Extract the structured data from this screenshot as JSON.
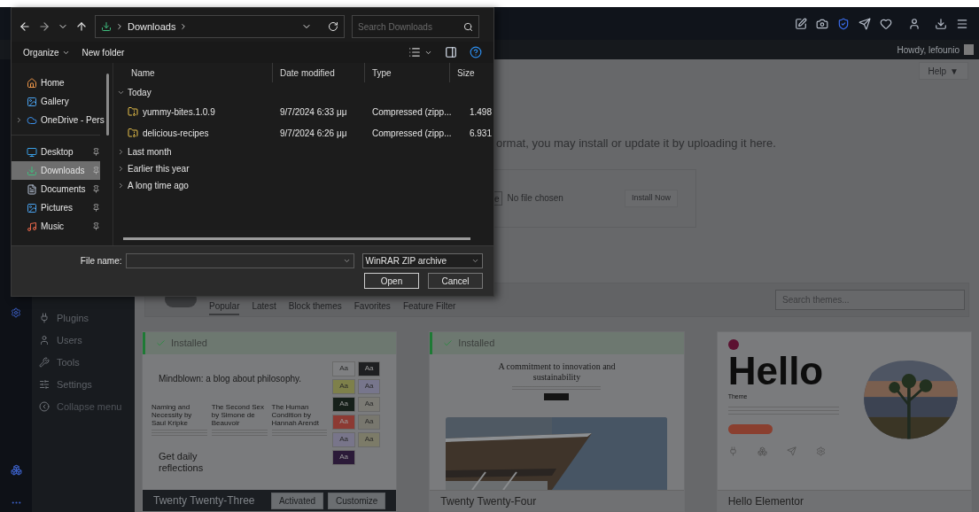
{
  "admin_bar": {
    "greeting": "Howdy, lefounio"
  },
  "help": {
    "label": "Help",
    "caret": "▼"
  },
  "upload": {
    "intro": "ormat, you may install or update it by uploading it here.",
    "choose_button": "e",
    "file_status": "No file chosen",
    "install_button": "Install Now"
  },
  "admin_menu": [
    {
      "label": "Plugins",
      "kind": "plugins"
    },
    {
      "label": "Users",
      "kind": "users"
    },
    {
      "label": "Tools",
      "kind": "tools"
    },
    {
      "label": "Settings",
      "kind": "settings"
    },
    {
      "label": "Collapse menu",
      "kind": "collapse"
    }
  ],
  "theme_filters": {
    "tabs": [
      {
        "label": "Popular",
        "selected": true
      },
      {
        "label": "Latest",
        "selected": false
      },
      {
        "label": "Block themes",
        "selected": false
      },
      {
        "label": "Favorites",
        "selected": false
      },
      {
        "label": "Feature Filter",
        "selected": false
      }
    ],
    "search_placeholder": "Search themes..."
  },
  "themes": [
    {
      "kind": "twentythree",
      "name": "Twenty Twenty-Three",
      "installed": true,
      "status": "Installed",
      "active": true,
      "actions": [
        "Activated",
        "Customize"
      ],
      "preview": {
        "headline": "Mindblown: a blog about philosophy.",
        "posts": [
          "Naming and Necessity by Saul Kripke",
          "The Second Sex by Simone de Beauvoir",
          "The Human Condition by Hannah Arendt"
        ],
        "footer_heading": "Get daily reflections",
        "swatches": [
          {
            "label": "Aa",
            "color": "#7f8082"
          },
          {
            "label": "Aa",
            "color": "#1e1f21"
          },
          {
            "label": "Aa",
            "color": "#7e804a"
          },
          {
            "label": "Aa",
            "color": "#77768c"
          },
          {
            "label": "Aa",
            "color": "#16201a"
          },
          {
            "label": "Aa",
            "color": "#7b7a74"
          },
          {
            "label": "Aa",
            "color": "#8c3a33"
          },
          {
            "label": "Aa",
            "color": "#78776e"
          },
          {
            "label": "Aa",
            "color": "#78758a"
          },
          {
            "label": "Aa",
            "color": "#7c7b68"
          },
          {
            "label": "Aa",
            "color": "#2b1a38"
          }
        ]
      }
    },
    {
      "kind": "twentyfour",
      "name": "Twenty Twenty-Four",
      "installed": true,
      "status": "Installed",
      "active": false,
      "preview": {
        "headline": "A commitment to innovation and sustainability"
      }
    },
    {
      "kind": "hello",
      "name": "Hello Elementor",
      "installed": false,
      "active": false,
      "preview": {
        "headline": "Hello",
        "subtitle": "Theme"
      }
    }
  ],
  "dialog": {
    "path": [
      "Downloads"
    ],
    "search_placeholder": "Search Downloads",
    "toolbar": [
      "Organize",
      "New folder"
    ],
    "nav_groups": [
      [
        {
          "label": "Home",
          "kind": "home",
          "selected": false,
          "pinned": false,
          "expandable": false
        },
        {
          "label": "Gallery",
          "kind": "gallery",
          "selected": false,
          "pinned": false,
          "expandable": false
        },
        {
          "label": "OneDrive - Pers",
          "kind": "cloud",
          "selected": false,
          "pinned": false,
          "expandable": true
        }
      ],
      [
        {
          "label": "Desktop",
          "kind": "desktop",
          "selected": false,
          "pinned": true,
          "expandable": false
        },
        {
          "label": "Downloads",
          "kind": "downloads",
          "selected": true,
          "pinned": true,
          "expandable": false
        },
        {
          "label": "Documents",
          "kind": "documents",
          "selected": false,
          "pinned": true,
          "expandable": false
        },
        {
          "label": "Pictures",
          "kind": "pictures",
          "selected": false,
          "pinned": true,
          "expandable": false
        },
        {
          "label": "Music",
          "kind": "music",
          "selected": false,
          "pinned": true,
          "expandable": false
        }
      ]
    ],
    "columns": [
      "Name",
      "Date modified",
      "Type",
      "Size"
    ],
    "groups": [
      {
        "label": "Today",
        "expanded": true,
        "files": [
          {
            "name": "yummy-bites.1.0.9",
            "date": "9/7/2024 6:33 μμ",
            "type": "Compressed (zipp...",
            "size": "1.498"
          },
          {
            "name": "delicious-recipes",
            "date": "9/7/2024 6:26 μμ",
            "type": "Compressed (zipp...",
            "size": "6.931"
          }
        ]
      },
      {
        "label": "Last month",
        "expanded": false
      },
      {
        "label": "Earlier this year",
        "expanded": false
      },
      {
        "label": "A long time ago",
        "expanded": false
      }
    ],
    "file_name_label": "File name:",
    "file_type": "WinRAR ZIP archive",
    "buttons": [
      "Open",
      "Cancel"
    ]
  }
}
